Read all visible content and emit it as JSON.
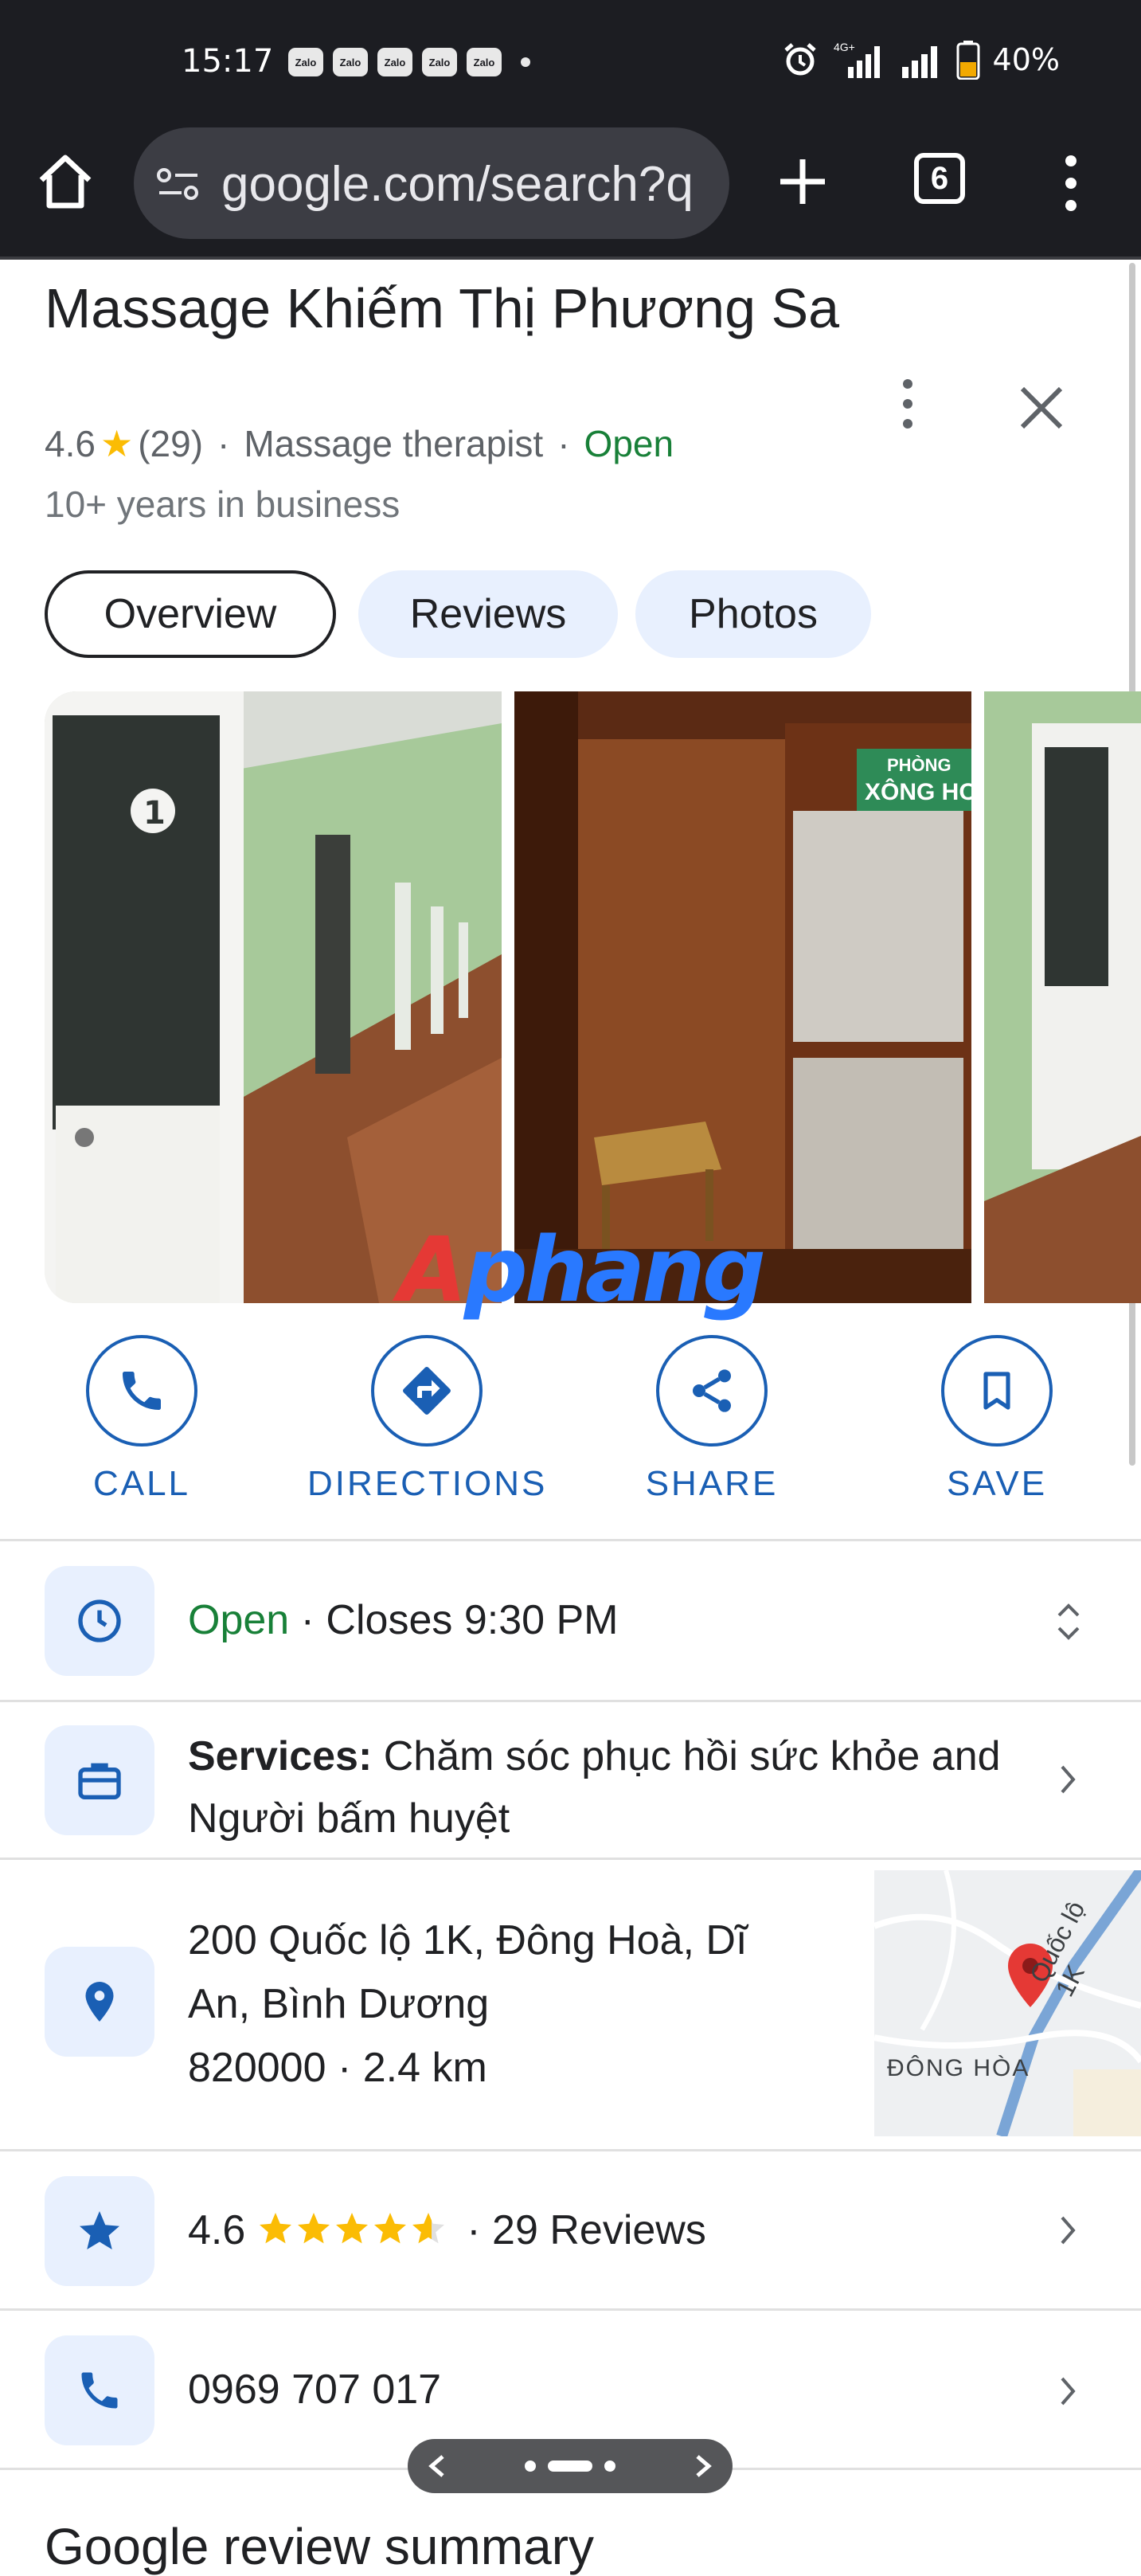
{
  "status_bar": {
    "time": "15:17",
    "notification_icons": [
      "Zalo",
      "Zalo",
      "Zalo",
      "Zalo",
      "Zalo"
    ],
    "battery": "40%",
    "network": "4G+",
    "icons": [
      "alarm-icon",
      "signal-icon",
      "signal-icon",
      "battery-icon"
    ]
  },
  "browser": {
    "url": "google.com/search?q",
    "tab_count": "6"
  },
  "place": {
    "title": "Massage Khiếm Thị Phương Sa",
    "rating": "4.6",
    "review_count": "(29)",
    "category": "Massage therapist",
    "status": "Open",
    "sep": "·",
    "years": "10+ years in business"
  },
  "tabs": [
    "Overview",
    "Reviews",
    "Photos"
  ],
  "photos": {
    "sign_line1": "PHÒNG",
    "sign_line2": "XÔNG HƠI",
    "door_number": "1",
    "watermark_a": "A",
    "watermark_b": "phang"
  },
  "actions": [
    "CALL",
    "DIRECTIONS",
    "SHARE",
    "SAVE"
  ],
  "hours": {
    "status": "Open",
    "detail": " · Closes 9:30 PM"
  },
  "services": {
    "label": "Services:",
    "value": " Chăm sóc phục hồi sức khỏe and Người bấm huyệt"
  },
  "address": {
    "line1": "200 Quốc lộ 1K, Đông Hoà, Dĩ",
    "line2": "An, Bình Dương",
    "line3": "820000 · 2.4 km",
    "map_area_label": "ĐÔNG HÒA",
    "map_road_label": "Quốc lộ 1K"
  },
  "reviews_row": {
    "rating": "4.6",
    "stars": 4.6,
    "text": "· 29 Reviews"
  },
  "phone": "0969 707 017",
  "next_section": "Google review summary",
  "colors": {
    "accent_blue": "#1a5fb4",
    "open_green": "#188038",
    "star": "#fbbc04",
    "chip_bg": "#e8f0fe"
  }
}
